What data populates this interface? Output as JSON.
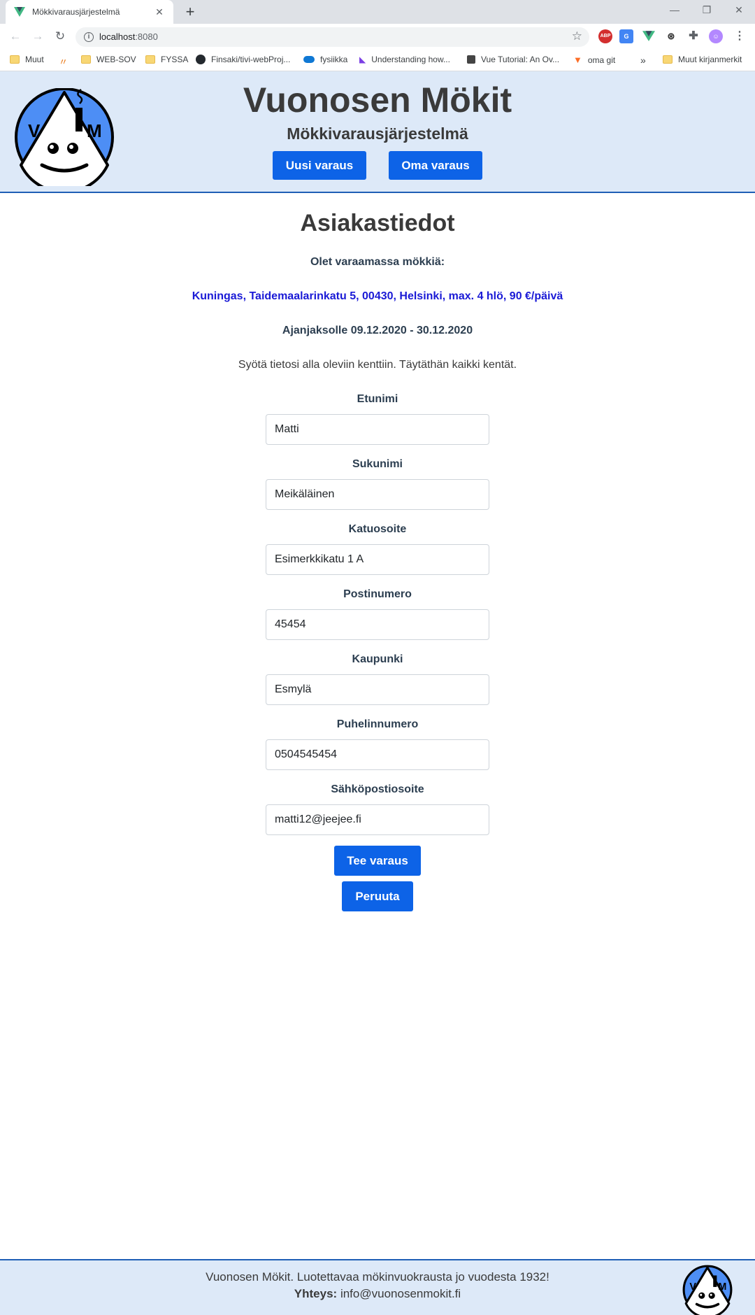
{
  "browser": {
    "tab_title": "Mökkivarausjärjestelmä",
    "url_host": "localhost",
    "url_port": ":8080",
    "bookmarks": [
      "Muut",
      "WEB-SOV",
      "FYSSA",
      "Finsaki/tivi-webProj...",
      "fysiikka",
      "Understanding how...",
      "Vue Tutorial: An Ov...",
      "oma git",
      "Muut kirjanmerkit"
    ],
    "more_bookmarks": "»",
    "extensions": {
      "abp": "ABP"
    }
  },
  "header": {
    "title": "Vuonosen Mökit",
    "subtitle": "Mökkivarausjärjestelmä",
    "new_booking": "Uusi varaus",
    "my_booking": "Oma varaus",
    "logo_letters": [
      "V",
      "M"
    ]
  },
  "main": {
    "heading": "Asiakastiedot",
    "booking_intro": "Olet varaamassa mökkiä:",
    "cabin_info": "Kuningas, Taidemaalarinkatu 5, 00430, Helsinki, max. 4 hlö, 90 €/päivä",
    "period": "Ajanjaksolle 09.12.2020 - 30.12.2020",
    "instructions": "Syötä tietosi alla oleviin kenttiin. Täytäthän kaikki kentät.",
    "fields": [
      {
        "label": "Etunimi",
        "value": "Matti"
      },
      {
        "label": "Sukunimi",
        "value": "Meikäläinen"
      },
      {
        "label": "Katuosoite",
        "value": "Esimerkkikatu 1 A"
      },
      {
        "label": "Postinumero",
        "value": "45454"
      },
      {
        "label": "Kaupunki",
        "value": "Esmylä"
      },
      {
        "label": "Puhelinnumero",
        "value": "0504545454"
      },
      {
        "label": "Sähköpostiosoite",
        "value": "matti12@jeejee.fi"
      }
    ],
    "submit": "Tee varaus",
    "cancel": "Peruuta"
  },
  "footer": {
    "tagline": "Vuonosen Mökit. Luotettavaa mökinvuokrausta jo vuodesta 1932!",
    "contact_label": "Yhteys:",
    "contact_email": "info@vuonosenmokit.fi"
  },
  "colors": {
    "accent": "#0d63e7",
    "header_bg": "#dde9f8",
    "cabin_text": "#1a1ad6",
    "logo_blue": "#4d8ef5"
  }
}
